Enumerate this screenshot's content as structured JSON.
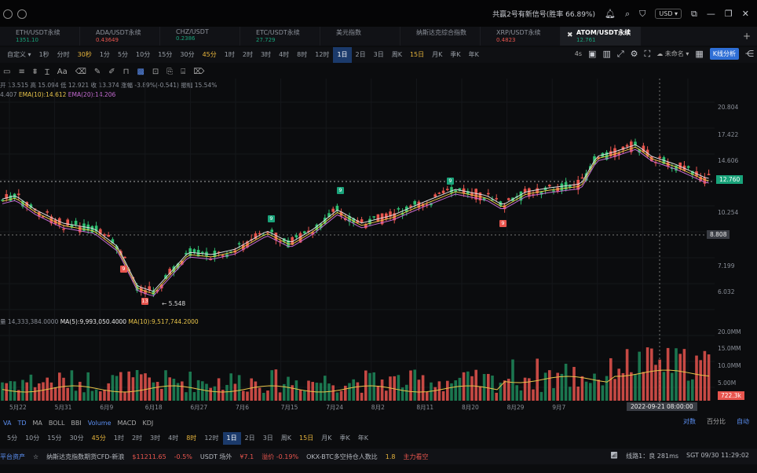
{
  "titlebar": {
    "signal": "共赢2号有新信号(胜率 66.89%)",
    "currency": "USD"
  },
  "tabs": [
    {
      "name": "ETH/USDT永续",
      "price": "1351.10",
      "color": "#19a37a"
    },
    {
      "name": "ADA/USDT永续",
      "price": "0.43649",
      "color": "#e8554e"
    },
    {
      "name": "CHZ/USDT",
      "price": "0.2386",
      "color": "#19a37a"
    },
    {
      "name": "ETC/USDT永续",
      "price": "27.729",
      "color": "#19a37a"
    },
    {
      "name": "美元指数",
      "price": "",
      "color": "#19a37a"
    },
    {
      "name": "纳斯达克综合指数",
      "price": "",
      "color": "#19a37a"
    },
    {
      "name": "XRP/USDT永续",
      "price": "0.4823",
      "color": "#e8554e"
    },
    {
      "name": "ATOM/USDT永续",
      "price": "12.761",
      "color": "#19a37a",
      "active": true
    }
  ],
  "intervals": [
    "自定义 ▾",
    "1秒",
    "分时",
    "30秒",
    "1分",
    "5分",
    "10分",
    "15分",
    "30分",
    "45分",
    "1时",
    "2时",
    "3时",
    "4时",
    "8时",
    "12时",
    "1日",
    "2日",
    "3日",
    "周K",
    "15日",
    "月K",
    "季K",
    "年K"
  ],
  "interval_highlight": [
    "30秒",
    "45分",
    "15日"
  ],
  "interval_selected": "1日",
  "right_tools": {
    "auto": "4s",
    "unnamed": "未命名",
    "kline_btn": "K线分析"
  },
  "ohlc": "开 13.515  高 15.094  低 12.921  收 13.374  涨幅 -3.89%(-0.541)  振幅 15.54%",
  "ema": {
    "ema5": "4.407",
    "ema10": "EMA(10):14.612",
    "ema20": "EMA(20):14.206"
  },
  "volume_info": {
    "vol": "量 14,333,384.0000",
    "ma5": "MA(5):9,993,050.4000",
    "ma10": "MA(10):9,517,744.2000"
  },
  "yaxis": [
    "20.804",
    "17.422",
    "14.606",
    "10.254",
    "7.199",
    "6.032"
  ],
  "current_price": "12.760",
  "cross_price": "8.808",
  "low_label": "← 5.548",
  "vol_axis": [
    "20.0MM",
    "15.0MM",
    "10.0MM",
    "5.00M"
  ],
  "vol_price": "722.3k",
  "xaxis": [
    "5月22",
    "5月31",
    "6月9",
    "6月18",
    "6月27",
    "7月6",
    "7月15",
    "7月24",
    "8月2",
    "8月11",
    "8月20",
    "8月29",
    "9月7"
  ],
  "x_cross": "2022-09-21 08:00:00",
  "indicators": [
    "VA",
    "TD",
    "MA",
    "BOLL",
    "BBI",
    "Volume",
    "MACD",
    "KDJ"
  ],
  "ind_active": [
    "VA",
    "TD",
    "Volume"
  ],
  "ind_right": [
    "对数",
    "百分比",
    "自动"
  ],
  "intervals2": [
    "5分",
    "10分",
    "15分",
    "30分",
    "45分",
    "1时",
    "2时",
    "3时",
    "4时",
    "8时",
    "12时",
    "1日",
    "2日",
    "3日",
    "周K",
    "15日",
    "月K",
    "季K",
    "年K"
  ],
  "intervals2_highlight": [
    "45分",
    "8时",
    "15日"
  ],
  "intervals2_selected": "1日",
  "bottombar": {
    "left": "平台资产",
    "nasdaq": "纳斯达克指数期货CFD-新浪",
    "nasdaq_val": "$11211.65",
    "nasdaq_chg": "-0.5%",
    "usdt": "USDT 场外",
    "usdt_val": "¥7.1",
    "usdt_chg": "溢价 -0.19%",
    "okx": "OKX-BTC多空持仓人数比",
    "okx_val": "1.8",
    "okx_tag": "主力看空",
    "line": "线路1：良 281ms",
    "time": "SGT 09/30 11:29:02"
  },
  "markers": [
    {
      "label": "9",
      "type": "r"
    },
    {
      "label": "13",
      "type": "r"
    },
    {
      "label": "9",
      "type": "g"
    },
    {
      "label": "9",
      "type": "g"
    },
    {
      "label": "9",
      "type": "g"
    },
    {
      "label": "9",
      "type": "r"
    }
  ]
}
